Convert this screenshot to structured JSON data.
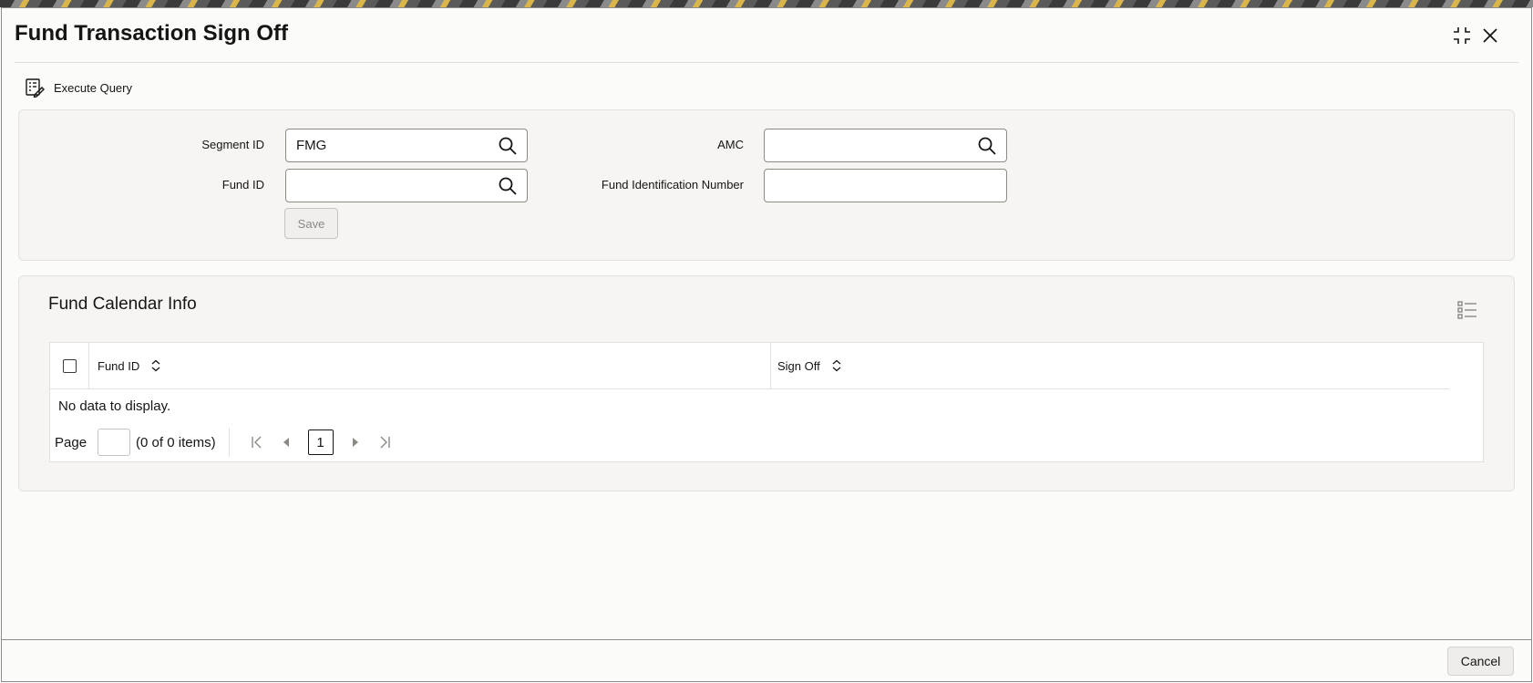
{
  "window": {
    "title": "Fund Transaction Sign Off",
    "controls": {
      "minimize_icon": "collapse-icon",
      "close_icon": "close-icon"
    }
  },
  "toolbar": {
    "execute_query_label": "Execute Query",
    "icon": "query-document-icon"
  },
  "form": {
    "segment_id": {
      "label": "Segment ID",
      "value": "FMG"
    },
    "amc": {
      "label": "AMC",
      "value": ""
    },
    "fund_id": {
      "label": "Fund ID",
      "value": ""
    },
    "fund_identification_number": {
      "label": "Fund Identification Number",
      "value": ""
    },
    "save_label": "Save"
  },
  "calendar": {
    "title": "Fund Calendar Info",
    "columns": [
      "Fund ID",
      "Sign Off"
    ],
    "empty_message": "No data to display.",
    "pager": {
      "page_label": "Page",
      "items_text": "(0 of 0 items)",
      "current_page": "1"
    }
  },
  "footer": {
    "cancel_label": "Cancel"
  },
  "colors": {
    "accent": "#161513",
    "panel_bg": "#f6f5f3",
    "border": "#8e8a84"
  }
}
